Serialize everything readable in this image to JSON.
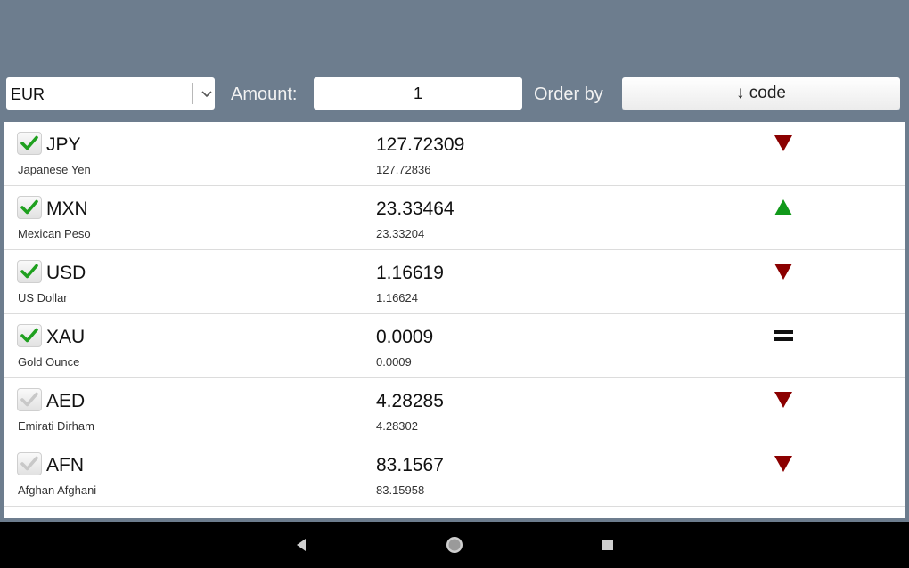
{
  "toolbar": {
    "currency": "EUR",
    "amount_label": "Amount:",
    "amount_value": "1",
    "order_label": "Order by",
    "order_button": "↓ code"
  },
  "rows": [
    {
      "code": "JPY",
      "name": "Japanese Yen",
      "rate": "127.72309",
      "previous": "127.72836",
      "checked": true,
      "trend": "down"
    },
    {
      "code": "MXN",
      "name": "Mexican Peso",
      "rate": "23.33464",
      "previous": "23.33204",
      "checked": true,
      "trend": "up"
    },
    {
      "code": "USD",
      "name": "US Dollar",
      "rate": "1.16619",
      "previous": "1.16624",
      "checked": true,
      "trend": "down"
    },
    {
      "code": "XAU",
      "name": "Gold Ounce",
      "rate": "0.0009",
      "previous": "0.0009",
      "checked": true,
      "trend": "equal"
    },
    {
      "code": "AED",
      "name": "Emirati Dirham",
      "rate": "4.28285",
      "previous": "4.28302",
      "checked": false,
      "trend": "down"
    },
    {
      "code": "AFN",
      "name": "Afghan Afghani",
      "rate": "83.1567",
      "previous": "83.15958",
      "checked": false,
      "trend": "down"
    }
  ],
  "colors": {
    "header_bg": "#6d7d8e",
    "check_on": "#1fa01f",
    "check_off": "#c8c8c8",
    "trend_down": "#8b0000",
    "trend_up": "#11991a",
    "trend_equal": "#111111"
  },
  "icons": {
    "dropdown": "chevron-down-icon",
    "checkbox": "checkmark-icon",
    "trend_down": "triangle-down-icon",
    "trend_up": "triangle-up-icon",
    "trend_equal": "equals-icon",
    "nav_back": "back-icon",
    "nav_home": "home-icon",
    "nav_recents": "recents-icon"
  }
}
